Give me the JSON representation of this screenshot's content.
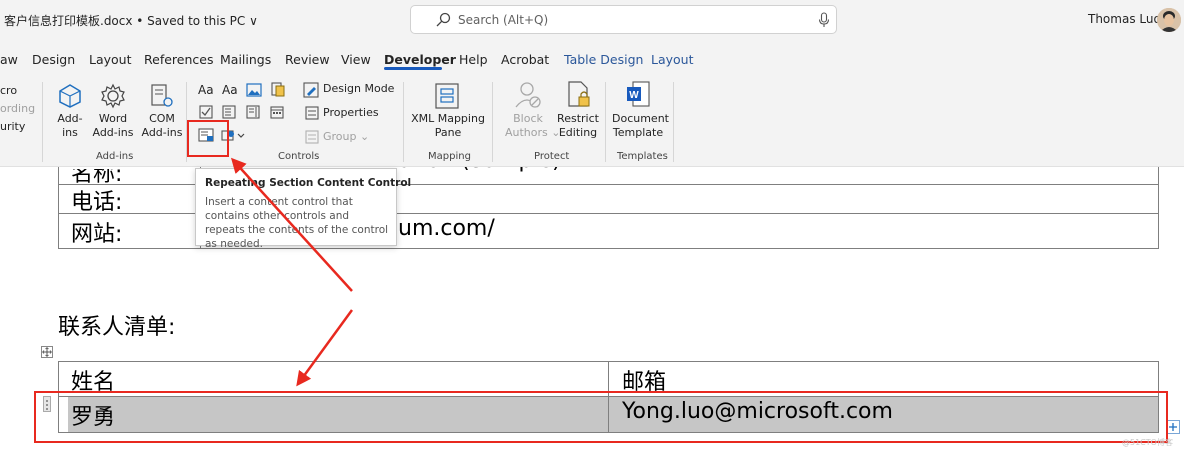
{
  "titlebar": {
    "doc_title": "客户信息打印模板.docx • Saved to this PC ∨",
    "search_placeholder": "Search (Alt+Q)",
    "user_name": "Thomas Luo"
  },
  "tabs": [
    "aw",
    "Design",
    "Layout",
    "References",
    "Mailings",
    "Review",
    "View",
    "Developer",
    "Help",
    "Acrobat",
    "Table Design",
    "Layout"
  ],
  "active_tab": "Developer",
  "ribbon": {
    "code": {
      "macro": "cro",
      "recording": "ording",
      "security": "urity"
    },
    "addins": {
      "addins_l1": "Add-",
      "addins_l2": "ins",
      "word_l1": "Word",
      "word_l2": "Add-ins",
      "com_l1": "COM",
      "com_l2": "Add-ins",
      "group": "Add-ins"
    },
    "controls": {
      "design_mode": "Design Mode",
      "properties": "Properties",
      "group_btn": "Group ⌄",
      "group": "Controls"
    },
    "mapping": {
      "xml_l1": "XML Mapping",
      "xml_l2": "Pane",
      "group": "Mapping"
    },
    "protect": {
      "block_l1": "Block",
      "block_l2": "Authors ⌄",
      "restrict_l1": "Restrict",
      "restrict_l2": "Editing",
      "group": "Protect"
    },
    "templates": {
      "doc_l1": "Document",
      "doc_l2": "Template",
      "group": "Templates"
    }
  },
  "tooltip": {
    "title": "Repeating Section Content Control",
    "body": "Insert a content control that contains other controls and repeats the contents of the control as needed."
  },
  "document": {
    "row1_label": "名称:",
    "row1_value_partial": "ution (Sample)",
    "row2_label": "电话:",
    "row3_label": "网站:",
    "row3_value_partial": "um.com/",
    "section_title": "联系人清单:",
    "contacts_headers": [
      "姓名",
      "邮箱"
    ],
    "contacts_rows": [
      [
        "罗勇",
        "Yong.luo@microsoft.com"
      ]
    ]
  },
  "watermark": "@51CTO博客",
  "colors": {
    "annotation_red": "#e8291f",
    "accent_blue": "#185abd",
    "ribbon_bg": "#f3f3f3"
  }
}
